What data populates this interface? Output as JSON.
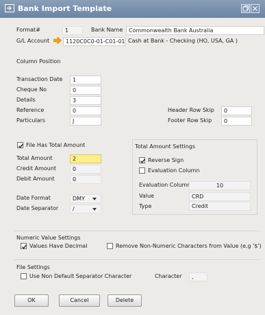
{
  "window": {
    "title": "Bank Import Template"
  },
  "header": {
    "format_label": "Format#",
    "format_value": "1",
    "bank_name_label": "Bank Name",
    "bank_name_value": "Commonwealth Bank Australia",
    "gl_account_label": "G/L Account",
    "gl_account_value": "1120C0C0-01-C01-01",
    "gl_account_desc": "Cash at Bank - Checking (HO, USA, GA )"
  },
  "column_positions": {
    "heading": "Column Position",
    "rows": [
      {
        "label": "Transaction Date",
        "value": "1"
      },
      {
        "label": "Cheque No",
        "value": "0"
      },
      {
        "label": "Details",
        "value": "3"
      },
      {
        "label": "Reference",
        "value": "0"
      },
      {
        "label": "Particulars",
        "value": "J"
      }
    ],
    "header_row_skip_label": "Header Row Skip",
    "header_row_skip_value": "0",
    "footer_row_skip_label": "Footer Row Skip",
    "footer_row_skip_value": "0"
  },
  "total_amount": {
    "has_total_label": "File Has Total Amount",
    "has_total_checked": true,
    "rows": [
      {
        "label": "Total Amount",
        "value": "2"
      },
      {
        "label": "Credit Amount",
        "value": "0"
      },
      {
        "label": "Debit Amount",
        "value": "0"
      }
    ]
  },
  "total_amount_settings": {
    "heading": "Total Amount Settings",
    "reverse_sign_label": "Reverse Sign",
    "reverse_sign_checked": true,
    "evaluation_column_label": "Evaluation Column",
    "evaluation_column_checked": false,
    "eval_col_field_label": "Evaluation Column",
    "eval_col_field_value": "10",
    "value_label": "Value",
    "value_value": "CRD",
    "type_label": "Type",
    "type_value": "Credit"
  },
  "dates": {
    "date_format_label": "Date Format",
    "date_format_value": "DMY",
    "date_separator_label": "Date Separator",
    "date_separator_value": "/"
  },
  "numeric": {
    "heading": "Numeric Value Settings",
    "has_decimal_label": "Values Have Decimal",
    "has_decimal_checked": true,
    "remove_non_numeric_label": "Remove Non-Numeric Characters from Value (e.g '$')",
    "remove_non_numeric_checked": false
  },
  "file_settings": {
    "heading": "File Settings",
    "non_default_sep_label": "Use Non Default Separator Character",
    "non_default_sep_checked": false,
    "character_label": "Character",
    "character_value": ","
  },
  "buttons": {
    "ok": "OK",
    "cancel": "Cancel",
    "delete": "Delete"
  }
}
